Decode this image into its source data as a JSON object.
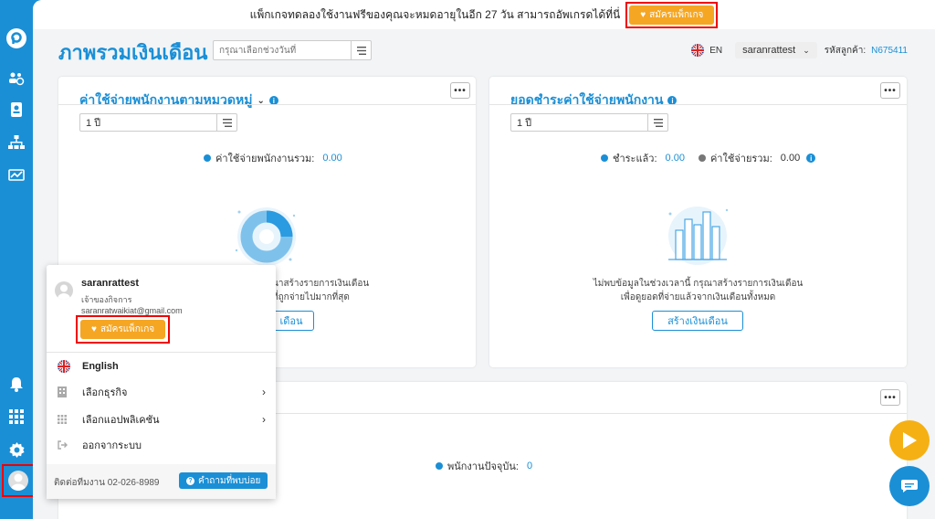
{
  "banner": {
    "text": "แพ็กเกจทดลองใช้งานฟรีของคุณจะหมดอายุในอีก 27 วัน สามารถอัพเกรดได้ที่นี่",
    "button_label": "สมัครแพ็กเกจ"
  },
  "page": {
    "title": "ภาพรวมเงินเดือน",
    "date_placeholder": "กรุณาเลือกช่วงวันที่"
  },
  "header": {
    "language": "EN",
    "username": "saranrattest",
    "customer_code_label": "รหัสลูกค้า:",
    "customer_code": "N675411"
  },
  "card1": {
    "title": "ค่าใช้จ่ายพนักงานตามหมวดหมู่",
    "period": "1 ปี",
    "total_label": "ค่าใช้จ่ายพนักงานรวม:",
    "total_value": "0.00",
    "empty_line1": "นาสร้างรายการเงินเดือน",
    "empty_line2": "ที่ถูกจ่ายไปมากที่สุด",
    "button": "เดือน"
  },
  "card2": {
    "title": "ยอดชำระค่าใช้จ่ายพนักงาน",
    "period": "1 ปี",
    "paid_label": "ชำระแล้ว:",
    "paid_value": "0.00",
    "total_label": "ค่าใช้จ่ายรวม:",
    "total_value": "0.00",
    "empty_line1": "ไม่พบข้อมูลในช่วงเวลานี้ กรุณาสร้างรายการเงินเดือน",
    "empty_line2": "เพื่อดูยอดที่จ่ายแล้วจากเงินเดือนทั้งหมด",
    "button": "สร้างเงินเดือน"
  },
  "card3": {
    "current_label": "พนักงานปัจจุบัน:",
    "current_value": "0"
  },
  "popup": {
    "name": "saranrattest",
    "role": "เจ้าของกิจการ",
    "email": "saranratwaikiat@gmail.com",
    "package_button": "สมัครแพ็กเกจ",
    "items": [
      {
        "label": "English"
      },
      {
        "label": "เลือกธุรกิจ"
      },
      {
        "label": "เลือกแอปพลิเคชัน"
      },
      {
        "label": "ออกจากระบบ"
      }
    ],
    "contact": "ติดต่อทีมงาน 02-026-8989",
    "faq": "คำถามที่พบบ่อย"
  },
  "colors": {
    "primary": "#1a8fd6",
    "accent": "#f5a623",
    "highlight": "#e00000"
  }
}
